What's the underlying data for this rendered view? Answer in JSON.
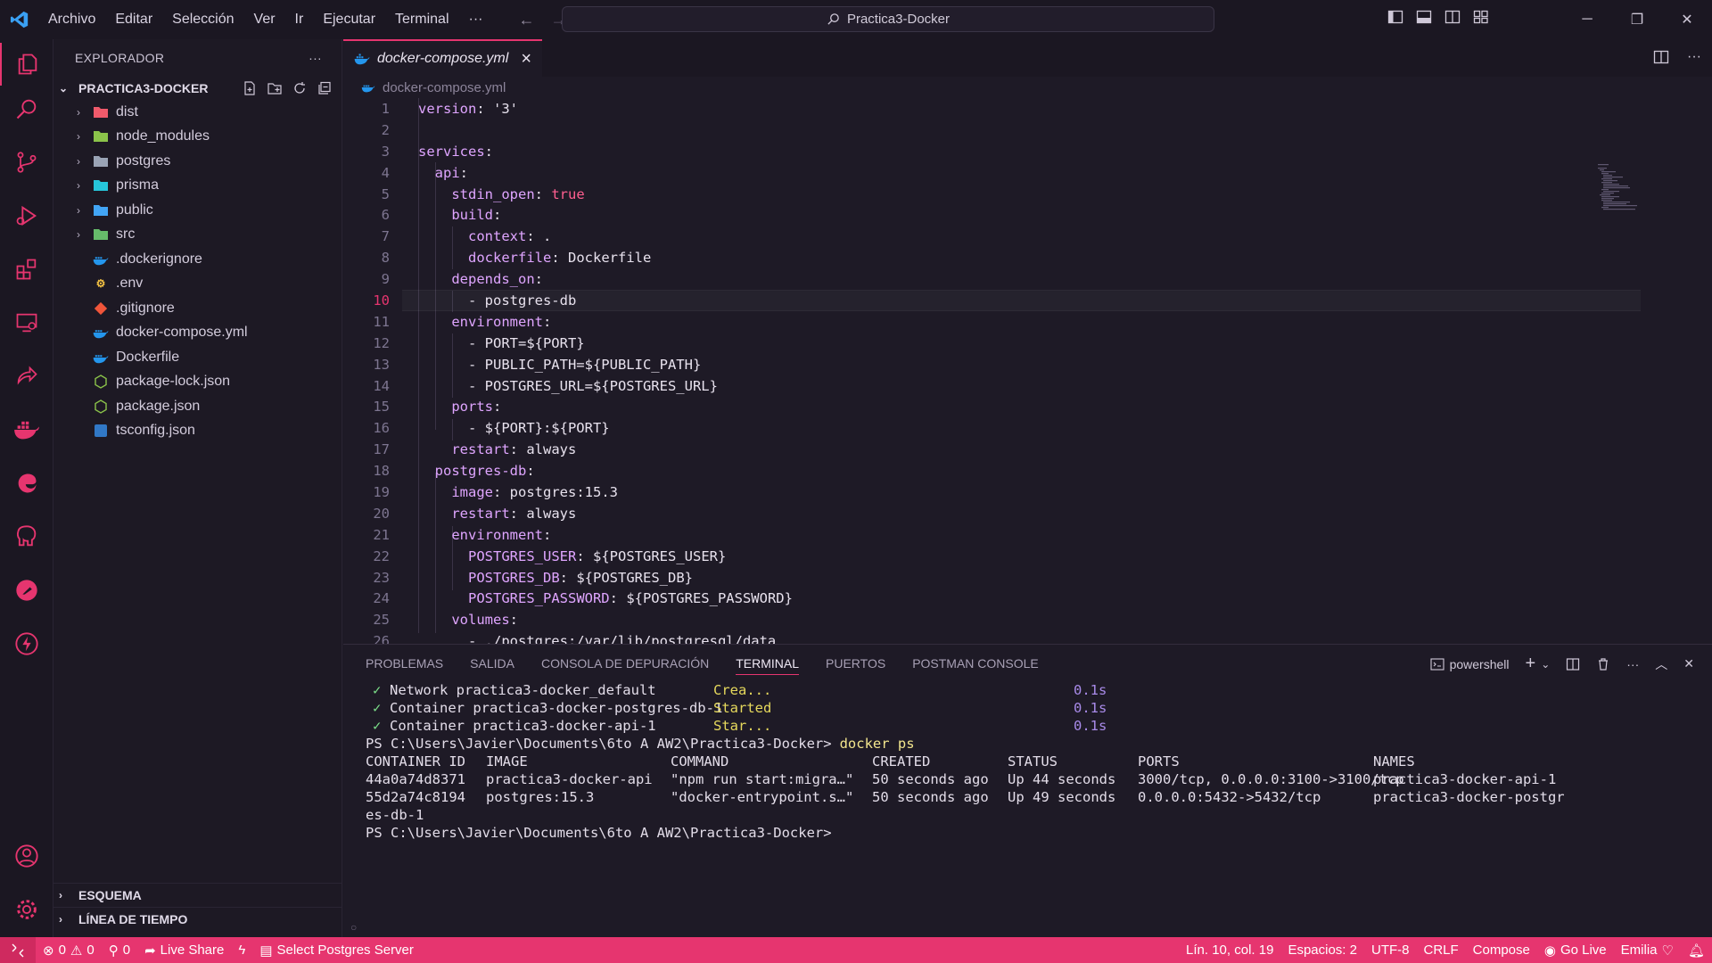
{
  "titlebar": {
    "menu": [
      "Archivo",
      "Editar",
      "Selección",
      "Ver",
      "Ir",
      "Ejecutar",
      "Terminal",
      "···"
    ],
    "search": "Practica3-Docker"
  },
  "sidebar": {
    "title": "EXPLORADOR",
    "more": "···",
    "folder": "PRACTICA3-DOCKER",
    "items": [
      {
        "label": "dist",
        "type": "folder",
        "icon": "folder-dist-icon",
        "color": "#f05a6b"
      },
      {
        "label": "node_modules",
        "type": "folder",
        "icon": "folder-node-icon",
        "color": "#8bc34a"
      },
      {
        "label": "postgres",
        "type": "folder",
        "icon": "folder-icon",
        "color": "#9aa3b5"
      },
      {
        "label": "prisma",
        "type": "folder",
        "icon": "folder-prisma-icon",
        "color": "#26c6da"
      },
      {
        "label": "public",
        "type": "folder",
        "icon": "folder-public-icon",
        "color": "#42a5f5"
      },
      {
        "label": "src",
        "type": "folder",
        "icon": "folder-src-icon",
        "color": "#66bb6a"
      },
      {
        "label": ".dockerignore",
        "type": "file",
        "icon": "docker-icon",
        "color": "#2496ed"
      },
      {
        "label": ".env",
        "type": "file",
        "icon": "env-icon",
        "color": "#f6c343"
      },
      {
        "label": ".gitignore",
        "type": "file",
        "icon": "git-icon",
        "color": "#f0553a"
      },
      {
        "label": "docker-compose.yml",
        "type": "file",
        "icon": "docker-icon",
        "color": "#2496ed"
      },
      {
        "label": "Dockerfile",
        "type": "file",
        "icon": "docker-icon",
        "color": "#2496ed"
      },
      {
        "label": "package-lock.json",
        "type": "file",
        "icon": "nodejs-icon",
        "color": "#8bc34a"
      },
      {
        "label": "package.json",
        "type": "file",
        "icon": "nodejs-icon",
        "color": "#8bc34a"
      },
      {
        "label": "tsconfig.json",
        "type": "file",
        "icon": "typescript-icon",
        "color": "#3178c6"
      }
    ],
    "outline": "ESQUEMA",
    "timeline": "LÍNEA DE TIEMPO"
  },
  "editor": {
    "tab": "docker-compose.yml",
    "tab_close": "×",
    "breadcrumb": "docker-compose.yml",
    "current_line": 10,
    "lines": [
      {
        "n": "1",
        "text": "version: '3'"
      },
      {
        "n": "2",
        "text": ""
      },
      {
        "n": "3",
        "text": "services:"
      },
      {
        "n": "4",
        "text": "  api:"
      },
      {
        "n": "5",
        "text": "    stdin_open: true"
      },
      {
        "n": "6",
        "text": "    build:"
      },
      {
        "n": "7",
        "text": "      context: ."
      },
      {
        "n": "8",
        "text": "      dockerfile: Dockerfile"
      },
      {
        "n": "9",
        "text": "    depends_on:"
      },
      {
        "n": "10",
        "text": "      - postgres-db"
      },
      {
        "n": "11",
        "text": "    environment:"
      },
      {
        "n": "12",
        "text": "      - PORT=${PORT}"
      },
      {
        "n": "13",
        "text": "      - PUBLIC_PATH=${PUBLIC_PATH}"
      },
      {
        "n": "14",
        "text": "      - POSTGRES_URL=${POSTGRES_URL}"
      },
      {
        "n": "15",
        "text": "    ports:"
      },
      {
        "n": "16",
        "text": "      - ${PORT}:${PORT}"
      },
      {
        "n": "17",
        "text": "    restart: always"
      },
      {
        "n": "18",
        "text": "  postgres-db:"
      },
      {
        "n": "19",
        "text": "    image: postgres:15.3"
      },
      {
        "n": "20",
        "text": "    restart: always"
      },
      {
        "n": "21",
        "text": "    environment:"
      },
      {
        "n": "22",
        "text": "      POSTGRES_USER: ${POSTGRES_USER}"
      },
      {
        "n": "23",
        "text": "      POSTGRES_DB: ${POSTGRES_DB}"
      },
      {
        "n": "24",
        "text": "      POSTGRES_PASSWORD: ${POSTGRES_PASSWORD}"
      },
      {
        "n": "25",
        "text": "    volumes:"
      },
      {
        "n": "26",
        "text": "      - ./postgres:/var/lib/postgresql/data"
      }
    ]
  },
  "panel": {
    "tabs": [
      "PROBLEMAS",
      "SALIDA",
      "CONSOLA DE DEPURACIÓN",
      "TERMINAL",
      "PUERTOS",
      "POSTMAN CONSOLE"
    ],
    "active_tab": "TERMINAL",
    "shell": "powershell"
  },
  "terminal": {
    "status_lines": [
      {
        "check": "✓",
        "text": "Network practica3-docker_default",
        "state": "Crea...",
        "time": "0.1s"
      },
      {
        "check": "✓",
        "text": "Container practica3-docker-postgres-db-1",
        "state": "Started",
        "time": "0.1s"
      },
      {
        "check": "✓",
        "text": "Container practica3-docker-api-1",
        "state": "Star...",
        "time": "0.1s"
      }
    ],
    "prompt": "PS C:\\Users\\Javier\\Documents\\6to A AW2\\Practica3-Docker>",
    "command": "docker ps",
    "table_headers": [
      "CONTAINER ID",
      "IMAGE",
      "COMMAND",
      "CREATED",
      "STATUS",
      "PORTS",
      "NAMES"
    ],
    "rows": [
      [
        "44a0a74d8371",
        "practica3-docker-api",
        "\"npm run start:migra…\"",
        "50 seconds ago",
        "Up 44 seconds",
        "3000/tcp, 0.0.0.0:3100->3100/tcp",
        "practica3-docker-api-1"
      ],
      [
        "55d2a74c8194",
        "postgres:15.3",
        "\"docker-entrypoint.s…\"",
        "50 seconds ago",
        "Up 49 seconds",
        "0.0.0.0:5432->5432/tcp",
        "practica3-docker-postgr"
      ]
    ],
    "wrap": "es-db-1",
    "final_prompt": "PS C:\\Users\\Javier\\Documents\\6to A AW2\\Practica3-Docker>"
  },
  "statusbar": {
    "errors": "0",
    "warnings": "0",
    "ports": "0",
    "live_share": "Live Share",
    "postgres": "Select Postgres Server",
    "position": "Lín. 10, col. 19",
    "spaces": "Espacios: 2",
    "encoding": "UTF-8",
    "eol": "CRLF",
    "language": "Compose",
    "go_live": "Go Live",
    "user": "Emilia"
  },
  "colors": {
    "accent": "#e6356f",
    "background": "#1e1a26",
    "keyword": "#dfa5ff",
    "boolean": "#ff5f90"
  }
}
